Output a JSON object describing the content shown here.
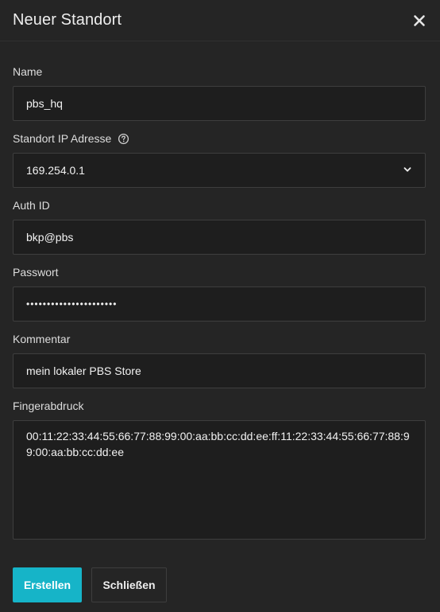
{
  "dialog": {
    "title": "Neuer Standort",
    "close_icon": "close-icon"
  },
  "fields": {
    "name": {
      "label": "Name",
      "value": "pbs_hq"
    },
    "ip": {
      "label": "Standort IP Adresse",
      "value": "169.254.0.1",
      "help_icon": "help-circle-icon",
      "chevron_icon": "chevron-down-icon"
    },
    "auth_id": {
      "label": "Auth ID",
      "value": "bkp@pbs"
    },
    "password": {
      "label": "Passwort",
      "value": "••••••••••••••••••••••"
    },
    "comment": {
      "label": "Kommentar",
      "value": "mein lokaler PBS Store"
    },
    "fingerprint": {
      "label": "Fingerabdruck",
      "value": "00:11:22:33:44:55:66:77:88:99:00:aa:bb:cc:dd:ee:ff:11:22:33:44:55:66:77:88:99:00:aa:bb:cc:dd:ee"
    }
  },
  "buttons": {
    "create_label": "Erstellen",
    "close_label": "Schließen"
  },
  "colors": {
    "background": "#252525",
    "input_background": "#1e1e1e",
    "accent": "#16b4c8"
  }
}
